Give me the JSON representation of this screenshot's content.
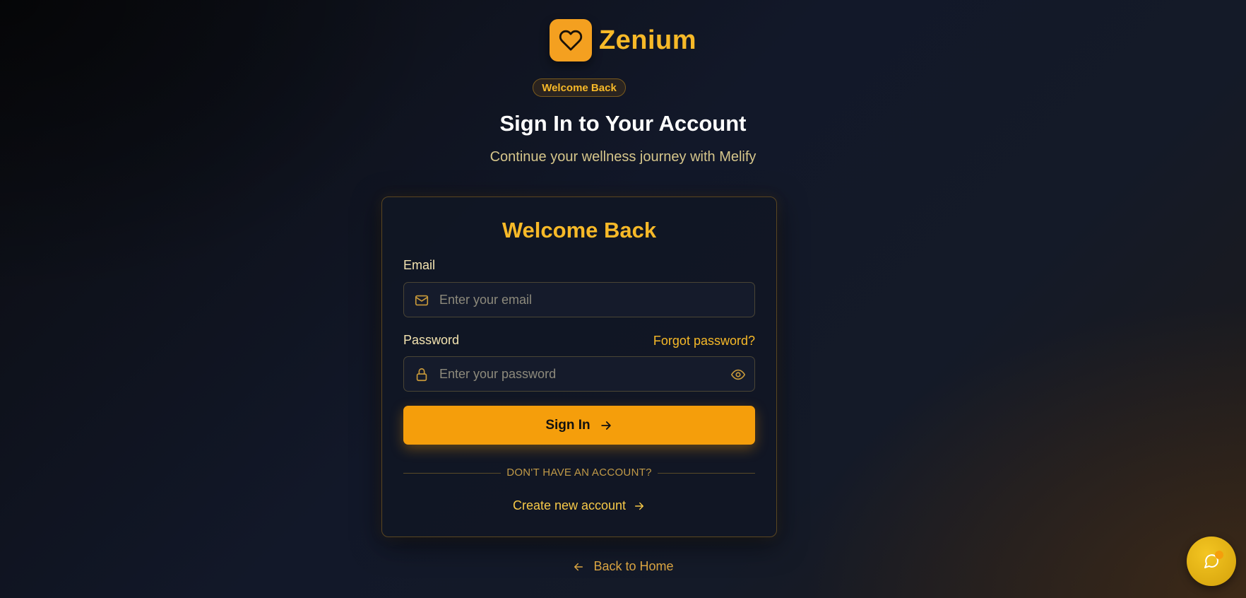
{
  "brand": {
    "name": "Zenium",
    "icon": "heart-icon"
  },
  "header": {
    "badge": "Welcome Back",
    "title": "Sign In to Your Account",
    "subtitle": "Continue your wellness journey with Melify"
  },
  "form": {
    "card_title": "Welcome Back",
    "email_label": "Email",
    "email_placeholder": "Enter your email",
    "email_value": "",
    "password_label": "Password",
    "password_placeholder": "Enter your password",
    "password_value": "",
    "forgot_label": "Forgot password?",
    "submit_label": "Sign In",
    "divider_text": "DON'T HAVE AN ACCOUNT?",
    "create_label": "Create new account"
  },
  "footer": {
    "back_label": "Back to Home"
  },
  "icons": [
    "heart-icon",
    "mail-icon",
    "lock-icon",
    "eye-icon",
    "arrow-right-icon",
    "arrow-left-icon",
    "chat-icon"
  ],
  "colors": {
    "accent": "#f59e0b",
    "accent_text": "#f7b928",
    "background": "#121829",
    "card": "#111624"
  }
}
